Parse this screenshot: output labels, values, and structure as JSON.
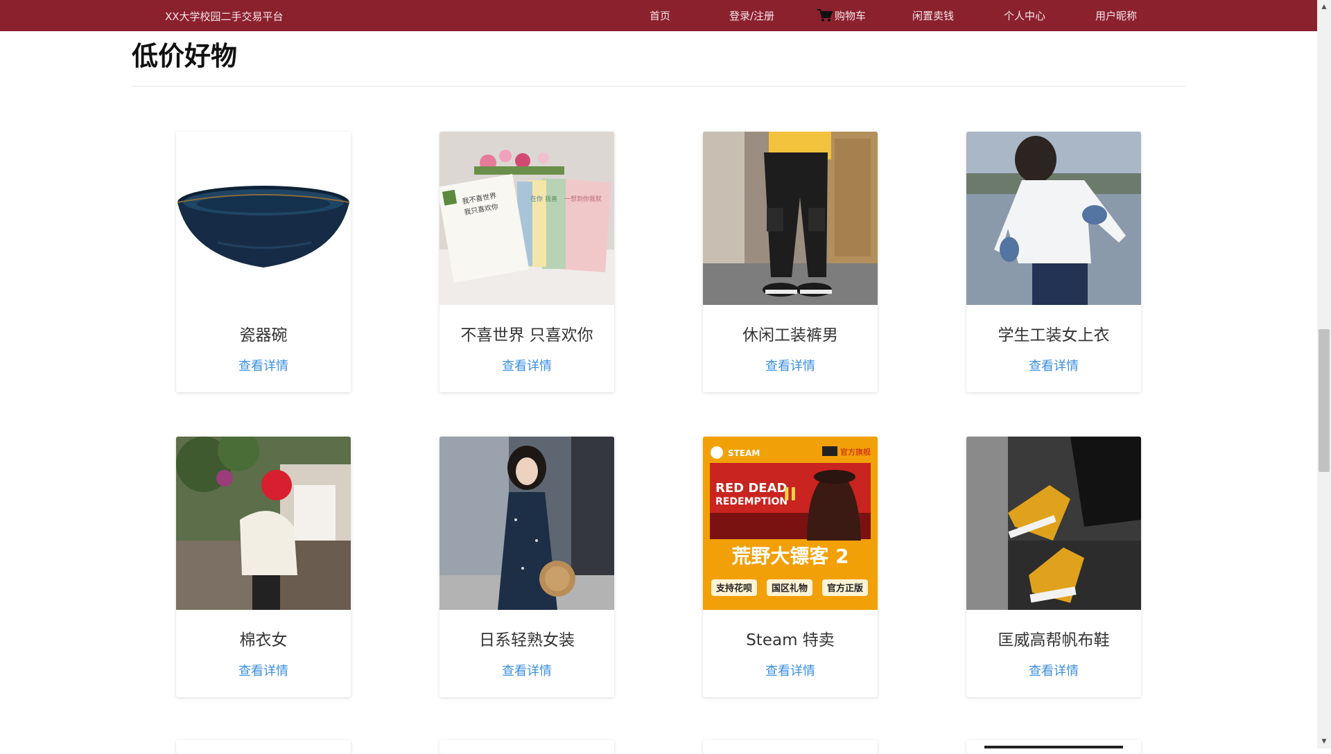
{
  "header": {
    "brand": "XX大学校园二手交易平台",
    "nav": [
      "首页",
      "登录/注册",
      "购物车",
      "闲置卖钱",
      "个人中心",
      "用户昵称"
    ]
  },
  "section": {
    "title": "低价好物"
  },
  "products": [
    {
      "name": "瓷器碗",
      "link": "查看详情"
    },
    {
      "name": "不喜世界 只喜欢你",
      "link": "查看详情"
    },
    {
      "name": "休闲工装裤男",
      "link": "查看详情"
    },
    {
      "name": "学生工装女上衣",
      "link": "查看详情"
    },
    {
      "name": "棉衣女",
      "link": "查看详情"
    },
    {
      "name": "日系轻熟女装",
      "link": "查看详情"
    },
    {
      "name": "Steam 特卖",
      "link": "查看详情"
    },
    {
      "name": "匡威高帮帆布鞋",
      "link": "查看详情"
    }
  ],
  "steam_banner": {
    "brand": "STEAM",
    "store": "官方旗舰",
    "game_en_1": "RED DEAD",
    "game_en_2": "REDEMPTION",
    "game_en_num": "II",
    "game_cn": "荒野大镖客 2",
    "tags": [
      "支持花呗",
      "国区礼物",
      "官方正版"
    ]
  },
  "book_cover_text": [
    "我不喜世界",
    "我只喜欢你",
    "在你",
    "我喜",
    "一想到你我就"
  ],
  "colors": {
    "header_bg": "#8c212e",
    "link": "#3b8fe0",
    "steam_orange": "#f2a007"
  }
}
